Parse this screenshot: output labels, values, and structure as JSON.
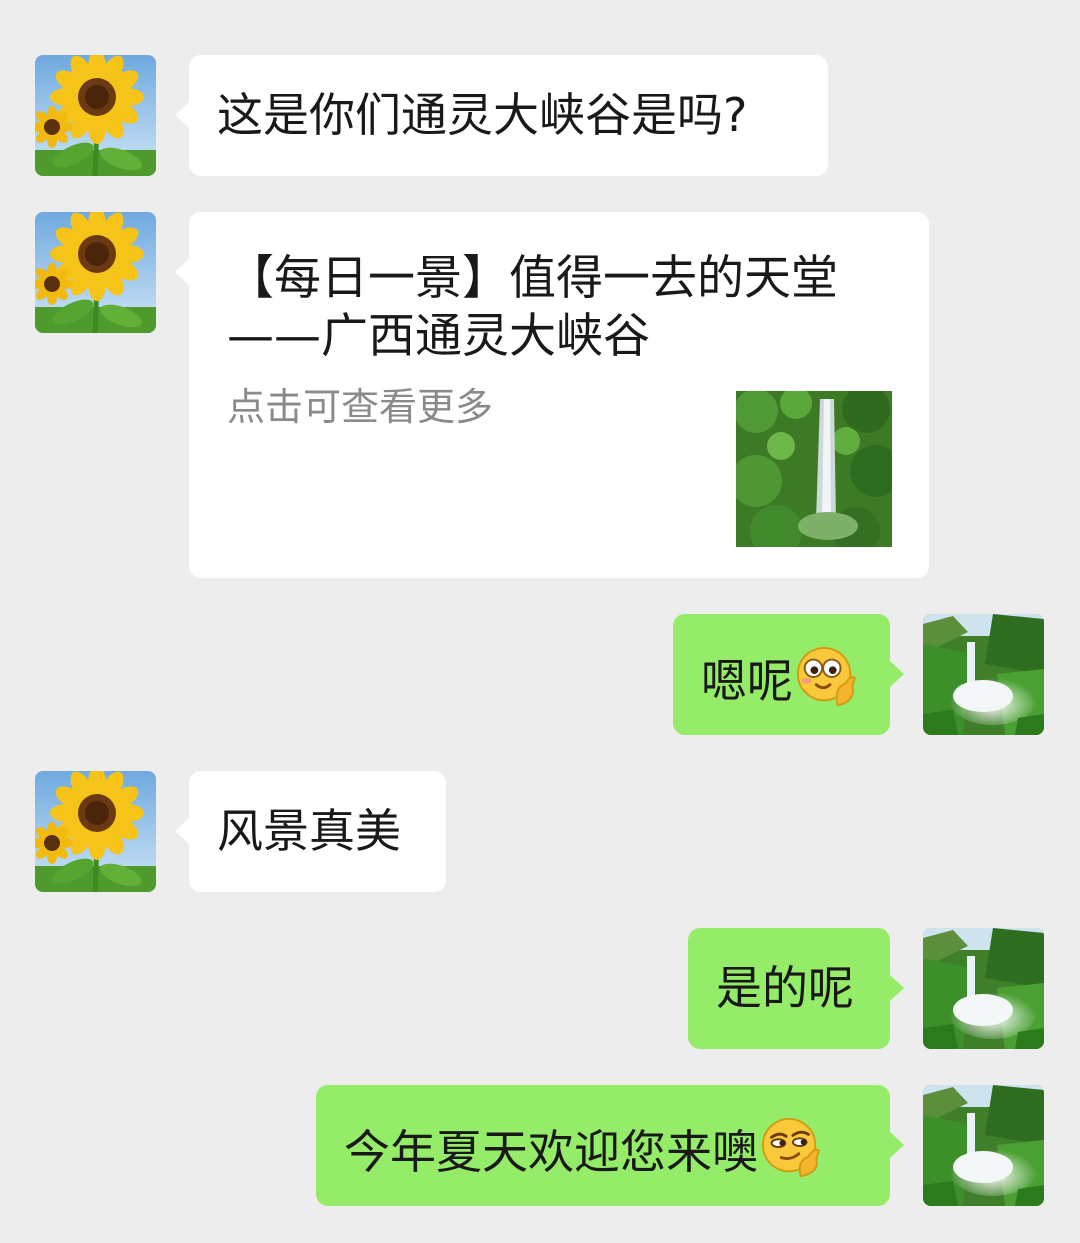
{
  "messages": [
    {
      "side": "left",
      "avatar": "sunflower-avatar",
      "text": "这是你们通灵大峡谷是吗?"
    },
    {
      "side": "left",
      "avatar": "sunflower-avatar",
      "type": "link-card",
      "title": "【每日一景】值得一去的天堂——广西通灵大峡谷",
      "description": "点击可查看更多",
      "thumbnail": "waterfall-thumbnail"
    },
    {
      "side": "right",
      "avatar": "waterfall-avatar",
      "text": "嗯呢",
      "emoji": "cheeky-emoji"
    },
    {
      "side": "left",
      "avatar": "sunflower-avatar",
      "text": "风景真美"
    },
    {
      "side": "right",
      "avatar": "waterfall-avatar",
      "text": "是的呢"
    },
    {
      "side": "right",
      "avatar": "waterfall-avatar",
      "text": "今年夏天欢迎您来噢",
      "emoji": "smirk-emoji"
    }
  ],
  "colors": {
    "background": "#ededed",
    "incoming_bubble": "#ffffff",
    "outgoing_bubble": "#95ec69",
    "link_desc": "#8a8a8a"
  }
}
